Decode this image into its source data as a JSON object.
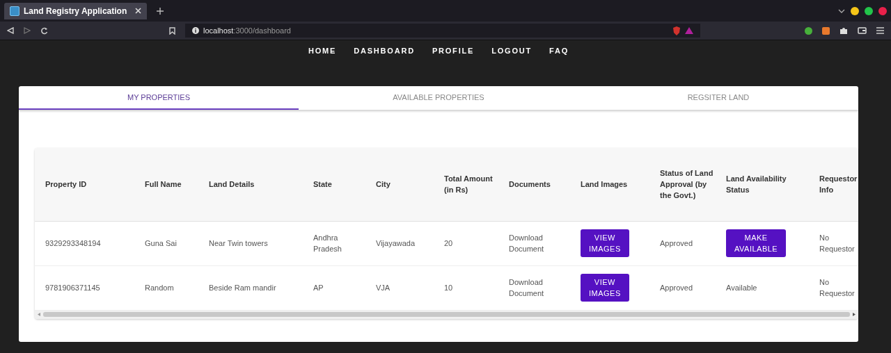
{
  "browser": {
    "tab_title": "Land Registry Application",
    "url_host": "localhost",
    "url_path": ":3000/dashboard"
  },
  "nav": [
    "HOME",
    "DASHBOARD",
    "PROFILE",
    "LOGOUT",
    "FAQ"
  ],
  "tabs": [
    {
      "label": "MY PROPERTIES",
      "selected": true
    },
    {
      "label": "AVAILABLE PROPERTIES",
      "selected": false
    },
    {
      "label": "REGSITER LAND",
      "selected": false
    }
  ],
  "table": {
    "columns": [
      "Property ID",
      "Full Name",
      "Land Details",
      "State",
      "City",
      "Total Amount (in Rs)",
      "Documents",
      "Land Images",
      "Status of Land Approval (by the Govt.)",
      "Land Availability Status",
      "Requestor Info"
    ],
    "rows": [
      [
        {
          "kind": "text",
          "text": "9329293348194"
        },
        {
          "kind": "text",
          "text": "Guna Sai"
        },
        {
          "kind": "text",
          "text": "Near Twin towers"
        },
        {
          "kind": "text",
          "text": "Andhra Pradesh"
        },
        {
          "kind": "text",
          "text": "Vijayawada"
        },
        {
          "kind": "text",
          "text": "20"
        },
        {
          "kind": "text",
          "text": "Download Document"
        },
        {
          "kind": "button",
          "text": "VIEW IMAGES"
        },
        {
          "kind": "text",
          "text": "Approved"
        },
        {
          "kind": "button",
          "text": "MAKE AVAILABLE"
        },
        {
          "kind": "text",
          "text": "No Requestor"
        }
      ],
      [
        {
          "kind": "text",
          "text": "9781906371145"
        },
        {
          "kind": "text",
          "text": "Random"
        },
        {
          "kind": "text",
          "text": "Beside Ram mandir"
        },
        {
          "kind": "text",
          "text": "AP"
        },
        {
          "kind": "text",
          "text": "VJA"
        },
        {
          "kind": "text",
          "text": "10"
        },
        {
          "kind": "text",
          "text": "Download Document"
        },
        {
          "kind": "button",
          "text": "VIEW IMAGES"
        },
        {
          "kind": "text",
          "text": "Approved"
        },
        {
          "kind": "text",
          "text": "Available"
        },
        {
          "kind": "text",
          "text": "No Requestor"
        }
      ]
    ]
  }
}
